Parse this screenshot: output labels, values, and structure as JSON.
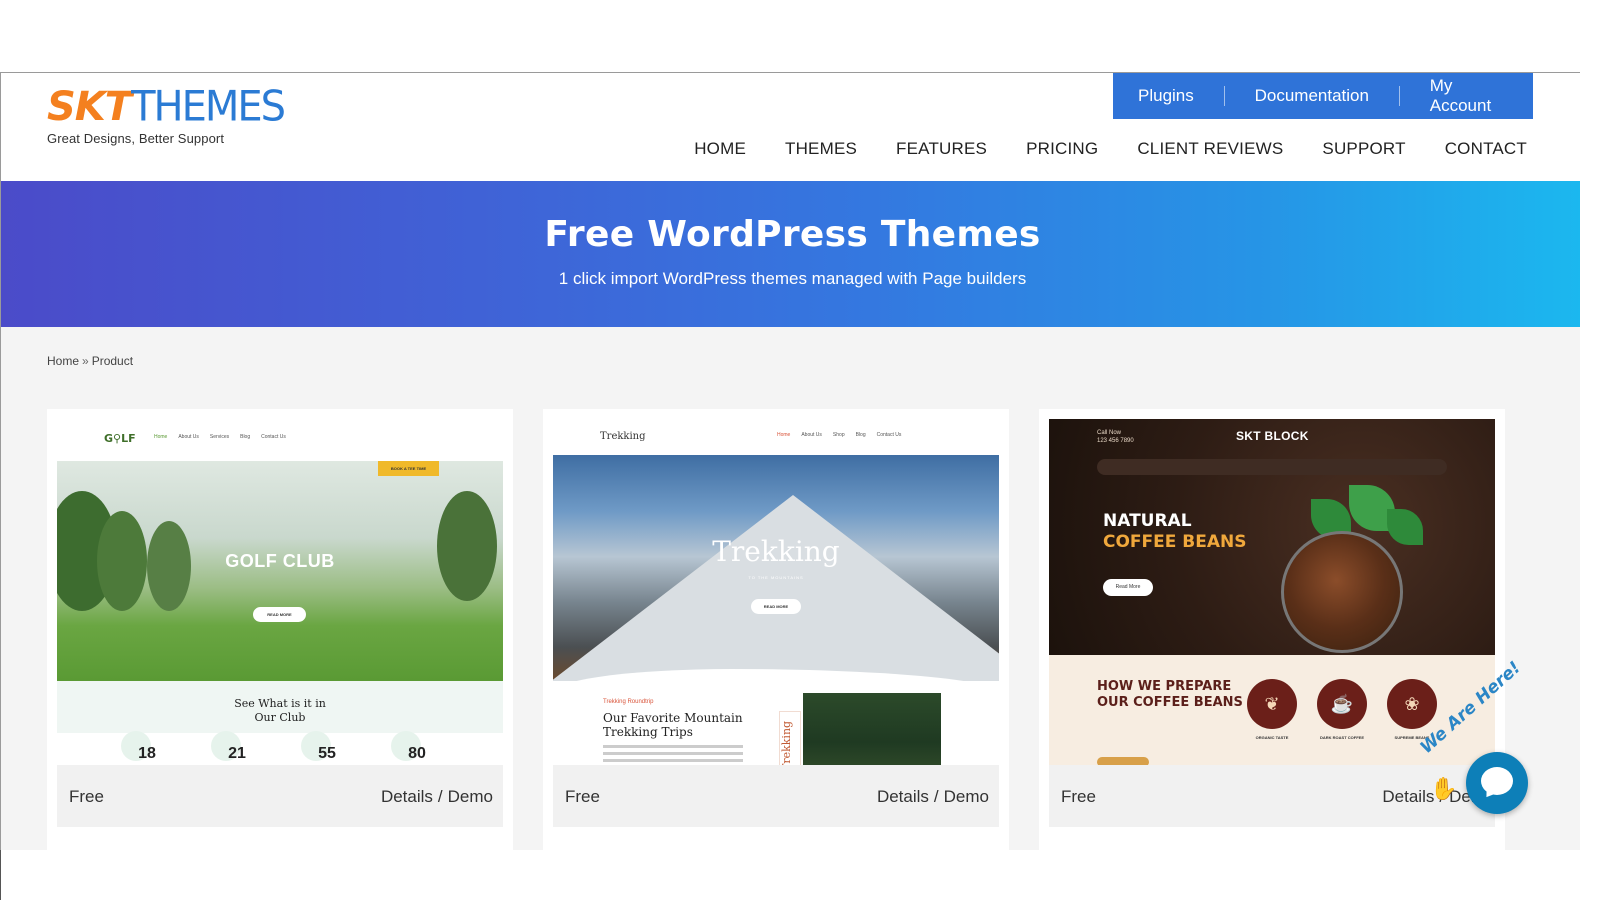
{
  "logo": {
    "mark_left": "SKT",
    "mark_right": "THEMES",
    "tagline": "Great Designs, Better Support"
  },
  "topbar": {
    "links": [
      "Plugins",
      "Documentation",
      "My Account"
    ]
  },
  "nav": [
    "HOME",
    "THEMES",
    "FEATURES",
    "PRICING",
    "CLIENT REVIEWS",
    "SUPPORT",
    "CONTACT"
  ],
  "hero": {
    "title": "Free WordPress Themes",
    "subtitle": "1 click import WordPress themes managed with Page builders"
  },
  "breadcrumb": {
    "home": "Home",
    "separator": "»",
    "current": "Product"
  },
  "cards": [
    {
      "price": "Free",
      "details": "Details",
      "slash": "/",
      "demo": "Demo",
      "preview": {
        "logo": "G⚲LF",
        "nav": [
          "Home",
          "About Us",
          "Services",
          "Blog",
          "Contact Us"
        ],
        "book": "BOOK A TEE TIME",
        "title": "GOLF CLUB",
        "button": "READ MORE",
        "sub_line1": "See What is it in",
        "sub_line2": "Our Club",
        "stats": [
          "18",
          "21",
          "55",
          "80"
        ]
      }
    },
    {
      "price": "Free",
      "details": "Details",
      "slash": "/",
      "demo": "Demo",
      "preview": {
        "logo": "Trekking",
        "nav": [
          "Home",
          "About Us",
          "Shop",
          "Blog",
          "Contact Us"
        ],
        "title": "Trekking",
        "tagline": "TO THE MOUNTAINS",
        "button": "READ MORE",
        "kicker": "Trekking Roundtrip",
        "head_line1": "Our Favorite Mountain",
        "head_line2": "Trekking Trips",
        "vertical": "Trekking"
      }
    },
    {
      "price": "Free",
      "details": "Details",
      "slash": "/",
      "demo": "Dem",
      "preview": {
        "logo": "SKT BLOCK",
        "call_label": "Call Now",
        "phone": "123 456 7890",
        "title_line1": "NATURAL",
        "title_line2": "COFFEE BEANS",
        "button": "Read More",
        "bottom_line1": "HOW WE PREPARE",
        "bottom_line2": "OUR COFFEE BEANS",
        "features": [
          "ORGANIC TASTE",
          "DARK ROAST COFFEE",
          "SUPREME BEANS"
        ]
      }
    }
  ],
  "chat": {
    "label": "We Are Here!"
  },
  "colors": {
    "accent": "#2f73d8",
    "brand_orange": "#f4801f",
    "brand_blue": "#2b7bd4"
  }
}
